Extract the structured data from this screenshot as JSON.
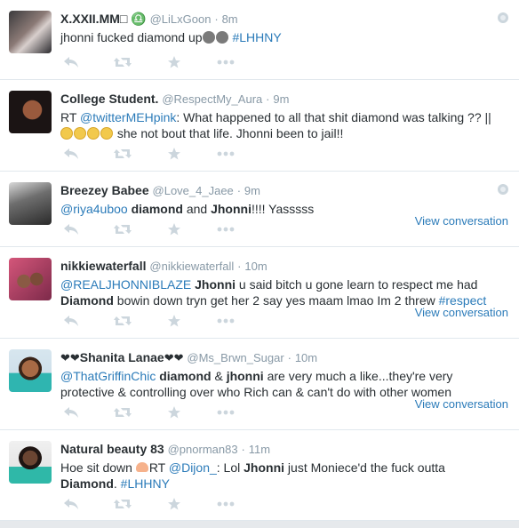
{
  "tweets": [
    {
      "name": "X.XXII.MM□ ♎",
      "handle": "@LiLxGoon",
      "time": "8m",
      "text": {
        "p1": "jhonni fucked diamond up",
        "tag": "#LHHNY"
      },
      "icons": {
        "emoji": "skull-emoji",
        "top_right": "globe-icon"
      }
    },
    {
      "name": "College Student.",
      "handle": "@RespectMy_Aura",
      "time": "9m",
      "text": {
        "p1": "RT ",
        "mention": "@twitterMEHpink",
        "p2": ": What happened to all that shit diamond was talking ?? ||",
        "p3": " she not bout that life. Jhonni been to jail!!"
      },
      "icons": {
        "emoji": "laughing-emoji"
      }
    },
    {
      "name": "Breezey Babee",
      "handle": "@Love_4_Jaee",
      "time": "9m",
      "text": {
        "mention": "@riya4uboo",
        "b1": "diamond",
        "p1": " and ",
        "b2": "Jhonni",
        "p2": "!!!!  Yasssss"
      },
      "view_conversation": "View conversation",
      "icons": {
        "top_right": "globe-icon"
      }
    },
    {
      "name": "nikkiewaterfall",
      "handle": "@nikkiewaterfall",
      "time": "10m",
      "text": {
        "mention": "@REALJHONNIBLAZE",
        "b1": "Jhonni",
        "p1": " u  said bitch u gone learn to respect me had",
        "b2": "Diamond",
        "p2": " bowin down tryn get her 2 say yes maam lmao Im 2 threw ",
        "tag": "#respect"
      },
      "view_conversation": "View conversation"
    },
    {
      "name": "Shanita Lanae",
      "handle": "@Ms_Brwn_Sugar",
      "time": "10m",
      "text": {
        "mention": "@ThatGriffinChic",
        "b1": "diamond",
        "p1": " & ",
        "b2": "jhonni",
        "p2": " are very much a like...they're very protective & controlling over who Rich can & can't do with other women"
      },
      "view_conversation": "View conversation",
      "icons": {
        "name_decoration": "heart-icon"
      }
    },
    {
      "name": "Natural beauty 83",
      "handle": "@pnorman83",
      "time": "11m",
      "text": {
        "p1": "Hoe sit down ",
        "p2": "RT ",
        "mention": "@Dijon_",
        "p3": ": Lol ",
        "b1": "Jhonni",
        "p4": " just Moniece'd the fuck outta",
        "b2": "Diamond",
        "p5": ". ",
        "tag": "#LHHNY"
      },
      "icons": {
        "emoji": "peach-emoji"
      }
    }
  ],
  "actions": [
    "reply-icon",
    "retweet-icon",
    "favorite-icon",
    "more-icon"
  ],
  "colors": {
    "link": "#2b7bb9",
    "meta": "#8899a6",
    "icon": "#ccd6dd",
    "divider": "#e1e8ed"
  }
}
